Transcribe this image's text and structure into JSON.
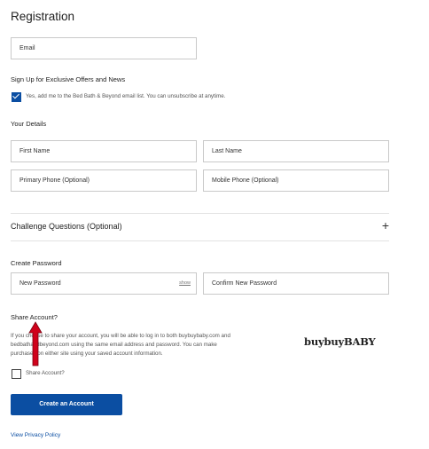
{
  "page": {
    "title": "Registration"
  },
  "email": {
    "placeholder": "Email"
  },
  "offers": {
    "heading": "Sign Up for Exclusive Offers and News",
    "checkbox_text": "Yes, add me to the Bed Bath & Beyond email list. You can unsubscribe at anytime.",
    "checked": true
  },
  "details": {
    "heading": "Your Details",
    "first_name": "First Name",
    "last_name": "Last Name",
    "primary_phone": "Primary Phone (Optional)",
    "mobile_phone": "Mobile Phone (Optional)"
  },
  "challenge": {
    "label": "Challenge Questions (Optional)",
    "expand": "+"
  },
  "password": {
    "heading": "Create Password",
    "new": "New Password",
    "show": "show",
    "confirm": "Confirm New Password"
  },
  "share": {
    "heading": "Share Account?",
    "body_line1": "If you choose to share your account, you will be able to log in to both buybuybaby.com and",
    "body_line2": "bedbathandbeyond.com using the same email address and password. You can make",
    "body_line3": "purchases on either site using your saved account information.",
    "logo": "buybuyBABY",
    "checkbox_label": "Share Account?",
    "checked": false
  },
  "actions": {
    "create": "Create an Account",
    "privacy": "View Privacy Policy"
  },
  "colors": {
    "primary": "#0b4ea2",
    "annotation": "#d0021b"
  },
  "annotation": {
    "icon": "arrow-up-icon"
  }
}
